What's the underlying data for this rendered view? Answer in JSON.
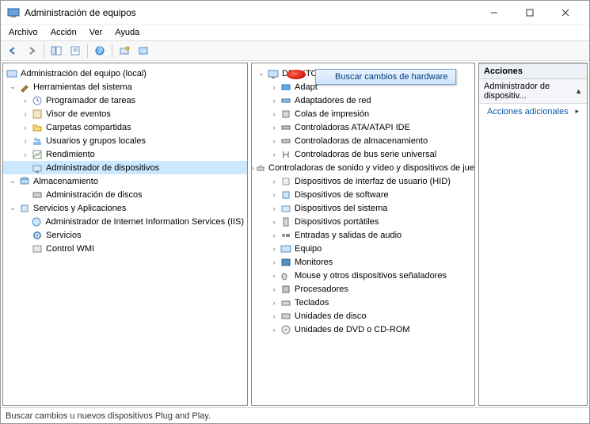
{
  "window": {
    "title": "Administración de equipos"
  },
  "menu": {
    "file": "Archivo",
    "action": "Acción",
    "view": "Ver",
    "help": "Ayuda"
  },
  "left_tree": {
    "root": "Administración del equipo (local)",
    "cat1": "Herramientas del sistema",
    "n_tasksched": "Programador de tareas",
    "n_eventvwr": "Visor de eventos",
    "n_shared": "Carpetas compartidas",
    "n_users": "Usuarios y grupos locales",
    "n_perf": "Rendimiento",
    "n_devmgr": "Administrador de dispositivos",
    "cat2": "Almacenamiento",
    "n_diskmgmt": "Administración de discos",
    "cat3": "Servicios y Aplicaciones",
    "n_iis": "Administrador de Internet Information Services (IIS)",
    "n_svc": "Servicios",
    "n_wmi": "Control WMI"
  },
  "mid_tree": {
    "root": "DESKTOP-",
    "n_adapt": "Adapt",
    "items": [
      "Adaptadores de red",
      "Colas de impresión",
      "Controladoras ATA/ATAPI IDE",
      "Controladoras de almacenamiento",
      "Controladoras de bus serie universal",
      "Controladoras de sonido y vídeo y dispositivos de juego",
      "Dispositivos de interfaz de usuario (HID)",
      "Dispositivos de software",
      "Dispositivos del sistema",
      "Dispositivos portátiles",
      "Entradas y salidas de audio",
      "Equipo",
      "Monitores",
      "Mouse y otros dispositivos señaladores",
      "Procesadores",
      "Teclados",
      "Unidades de disco",
      "Unidades de DVD o CD-ROM"
    ]
  },
  "context_menu": {
    "scan": "Buscar cambios de hardware"
  },
  "actions": {
    "header": "Acciones",
    "sub": "Administrador de dispositiv...",
    "more": "Acciones adicionales"
  },
  "statusbar": {
    "text": "Buscar cambios u nuevos dispositivos Plug and Play."
  },
  "icons": {
    "mgmt": "mgmt-icon",
    "folder": "folder-icon"
  }
}
